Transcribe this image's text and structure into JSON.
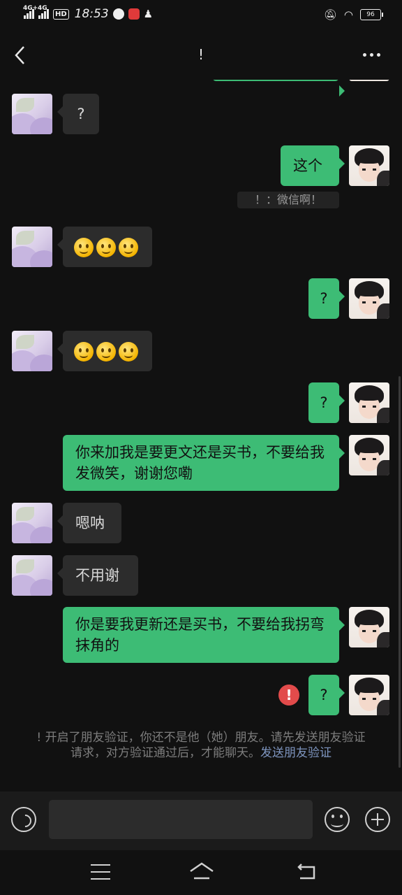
{
  "status_bar": {
    "net1": "4G+",
    "net2": "4G",
    "hd": "HD",
    "time": "18:53",
    "battery": "96"
  },
  "header": {
    "title": "!"
  },
  "messages": [
    {
      "side": "left",
      "kind": "text",
      "text": "?"
    },
    {
      "side": "right",
      "kind": "text",
      "text": "这个"
    },
    {
      "side": "center",
      "kind": "system",
      "text": "！：微信啊！"
    },
    {
      "side": "left",
      "kind": "emoji",
      "count": 3
    },
    {
      "side": "right",
      "kind": "text",
      "text": "?"
    },
    {
      "side": "left",
      "kind": "emoji",
      "count": 3
    },
    {
      "side": "right",
      "kind": "text",
      "text": "?"
    },
    {
      "side": "right",
      "kind": "text",
      "text": "你来加我是要更文还是买书，不要给我发微笑，谢谢您嘞"
    },
    {
      "side": "left",
      "kind": "text",
      "text": "嗯呐"
    },
    {
      "side": "left",
      "kind": "text",
      "text": "不用谢"
    },
    {
      "side": "right",
      "kind": "text",
      "text": "你是要我更新还是买书，不要给我拐弯抹角的"
    },
    {
      "side": "right",
      "kind": "text",
      "text": "?",
      "failed": true
    }
  ],
  "system_notice": {
    "text": "! 开启了朋友验证，你还不是他（她）朋友。请先发送朋友验证请求，对方验证通过后，才能聊天。",
    "link": "发送朋友验证"
  },
  "input_bar": {
    "placeholder": "",
    "voice_icon": "voice-icon",
    "emoji_icon": "emoji-icon",
    "plus_icon": "plus-icon"
  },
  "colors": {
    "background": "#111111",
    "incoming_bubble": "#2c2c2c",
    "outgoing_bubble": "#3dbc75",
    "error": "#e24b4b",
    "link": "#7e95bf"
  }
}
